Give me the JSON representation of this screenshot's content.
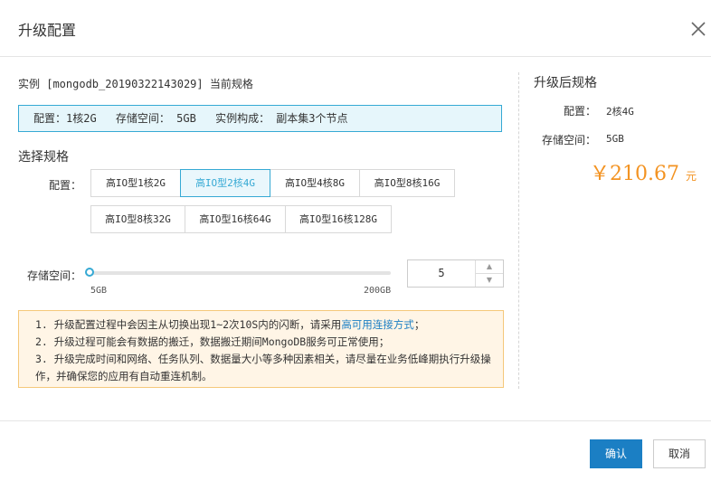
{
  "dialog": {
    "title": "升级配置"
  },
  "current": {
    "line": "实例 [mongodb_20190322143029] 当前规格"
  },
  "info": {
    "config": "配置：1核2G",
    "storage": "存储空间： 5GB",
    "composition": "实例构成： 副本集3个节点"
  },
  "select": {
    "heading": "选择规格",
    "config_label": "配置："
  },
  "options": [
    {
      "label": "高IO型1核2G",
      "selected": false
    },
    {
      "label": "高IO型2核4G",
      "selected": true
    },
    {
      "label": "高IO型4核8G",
      "selected": false
    },
    {
      "label": "高IO型8核16G",
      "selected": false
    },
    {
      "label": "高IO型8核32G",
      "selected": false
    },
    {
      "label": "高IO型16核64G",
      "selected": false
    },
    {
      "label": "高IO型16核128G",
      "selected": false
    }
  ],
  "storage": {
    "label": "存储空间：",
    "min": "5GB",
    "max": "200GB",
    "value": "5",
    "slider_fraction": 0
  },
  "notice": {
    "l1a": "1. 升级配置过程中会因主从切换出现1~2次10S内的闪断，请采用",
    "l1link": "高可用连接方式",
    "l1b": "；",
    "l2": "2. 升级过程可能会有数据的搬迁，数据搬迁期间MongoDB服务可正常使用；",
    "l3": "3. 升级完成时间和网络、任务队列、数据量大小等多种因素相关，请尽量在业务低峰期执行升级操作，并确保您的应用有自动重连机制。"
  },
  "after": {
    "title": "升级后规格",
    "config_label": "配置：",
    "config_value": "2核4G",
    "storage_label": "存储空间：",
    "storage_value": "5GB",
    "price": "￥210.67",
    "unit": "元"
  },
  "buttons": {
    "confirm": "确认",
    "cancel": "取消"
  },
  "colors": {
    "accent": "#36a9d4",
    "primary_button": "#1b7fc4",
    "price": "#f39322",
    "warning_bg": "#fff5e6"
  }
}
